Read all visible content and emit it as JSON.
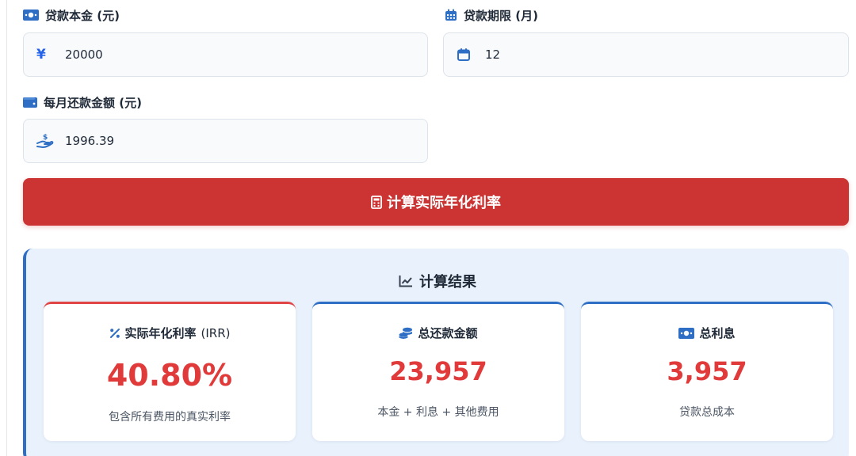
{
  "colors": {
    "primary_blue": "#2e6fc5",
    "button_red": "#cc3333",
    "value_red": "#e03a3a",
    "panel_bg": "#e8f1fc"
  },
  "form": {
    "principal": {
      "label": "贷款本金 (元)",
      "icon": "money-bill-icon",
      "prefix": "¥",
      "value": "20000"
    },
    "term": {
      "label": "贷款期限 (月)",
      "icon": "calendar-icon",
      "prefix_icon": "calendar-outline-icon",
      "value": "12"
    },
    "monthly": {
      "label": "每月还款金额 (元)",
      "icon": "wallet-icon",
      "prefix_icon": "hand-holding-dollar-icon",
      "value": "1996.39"
    }
  },
  "calculate_button": {
    "label": "计算实际年化利率",
    "icon": "calculator-icon"
  },
  "results": {
    "title": "计算结果",
    "title_icon": "chart-line-icon",
    "cards": [
      {
        "title": "实际年化利率",
        "unit": "(IRR)",
        "icon": "percent-icon",
        "value": "40.80%",
        "note": "包含所有费用的真实利率"
      },
      {
        "title": "总还款金额",
        "icon": "coins-icon",
        "value": "23,957",
        "note": "本金 + 利息 + 其他费用"
      },
      {
        "title": "总利息",
        "icon": "money-bill-icon",
        "value": "3,957",
        "note": "贷款总成本"
      }
    ]
  }
}
